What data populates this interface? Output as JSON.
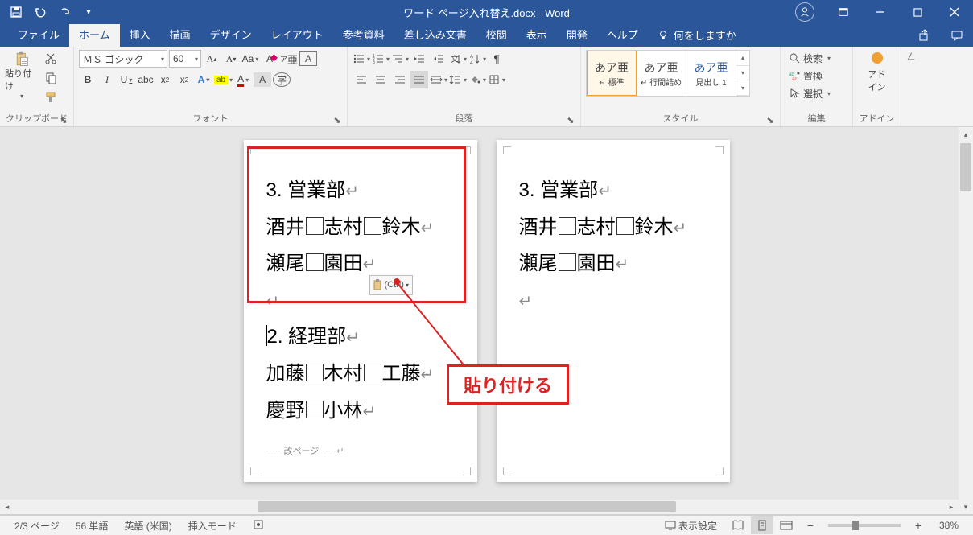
{
  "title": "ワード ページ入れ替え.docx  -  Word",
  "tabs": {
    "items": [
      "ファイル",
      "ホーム",
      "挿入",
      "描画",
      "デザイン",
      "レイアウト",
      "参考資料",
      "差し込み文書",
      "校閲",
      "表示",
      "開発",
      "ヘルプ"
    ],
    "active_index": 1,
    "tell_me": "何をしますか"
  },
  "ribbon": {
    "clipboard": {
      "paste": "貼り付け",
      "label": "クリップボード"
    },
    "font": {
      "name": "ＭＳ ゴシック",
      "size": "60",
      "label": "フォント"
    },
    "paragraph": {
      "label": "段落"
    },
    "styles": {
      "items": [
        {
          "preview": "あア亜",
          "name": "↵ 標準"
        },
        {
          "preview": "あア亜",
          "name": "↵ 行間詰め"
        },
        {
          "preview": "あア亜",
          "name": "見出し 1"
        }
      ],
      "label": "スタイル"
    },
    "editing": {
      "find": "検索",
      "replace": "置換",
      "select": "選択",
      "label": "編集"
    },
    "addin": {
      "label": "アドイン",
      "btn": "アド\nイン"
    }
  },
  "doc": {
    "page1": {
      "l1": "3. 営業部",
      "l2a": "酒井",
      "l2b": "志村",
      "l2c": "鈴木",
      "l3a": "瀬尾",
      "l3b": "園田",
      "paste_tag": "(Ctrl)",
      "l4": "2. 経理部",
      "l5a": "加藤",
      "l5b": "木村",
      "l5c": "工藤",
      "l6a": "慶野",
      "l6b": "小林",
      "page_break": "改ページ"
    },
    "page2": {
      "l1": "3. 営業部",
      "l2a": "酒井",
      "l2b": "志村",
      "l2c": "鈴木",
      "l3a": "瀬尾",
      "l3b": "園田"
    }
  },
  "annotation": {
    "text": "貼り付ける"
  },
  "status": {
    "page": "2/3 ページ",
    "words": "56 単語",
    "lang": "英語 (米国)",
    "insert": "挿入モード",
    "display": "表示設定",
    "zoom": "38%"
  }
}
